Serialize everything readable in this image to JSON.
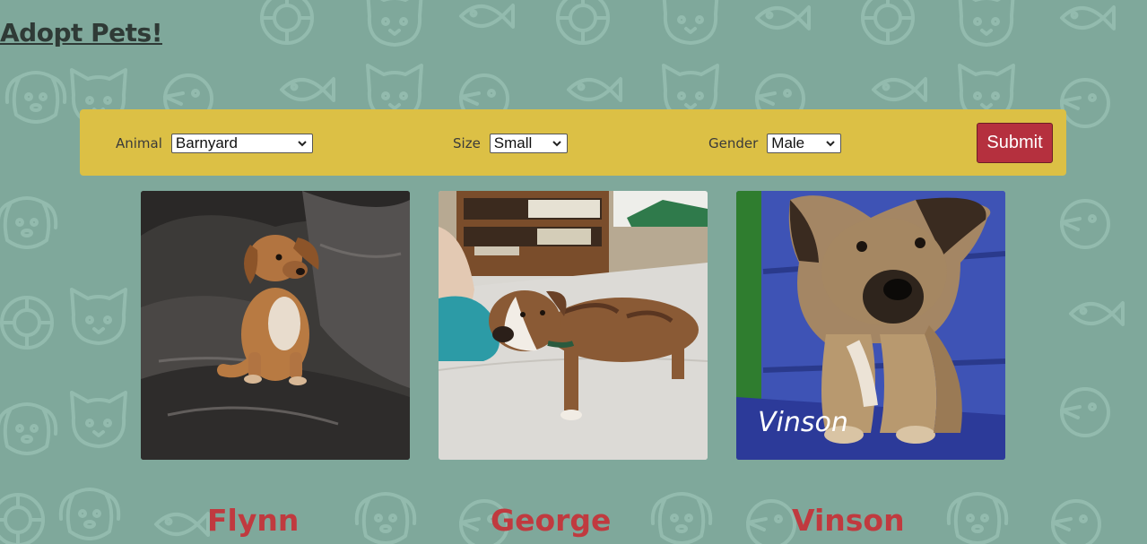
{
  "page": {
    "title": "Adopt Pets!"
  },
  "filters": {
    "animal": {
      "label": "Animal",
      "selected": "Barnyard"
    },
    "size": {
      "label": "Size",
      "selected": "Small"
    },
    "gender": {
      "label": "Gender",
      "selected": "Male"
    },
    "submit_label": "Submit"
  },
  "pets": [
    {
      "name": "Flynn",
      "photo_desc": "puppy-on-leather-couch"
    },
    {
      "name": "George",
      "photo_desc": "brindle-dog-in-shelter"
    },
    {
      "name": "Vinson",
      "photo_desc": "shepherd-puppy-on-blue-chair",
      "photo_caption": "Vinson"
    }
  ],
  "colors": {
    "background": "#7fa89b",
    "filter_bar": "#dcc045",
    "submit": "#b5303e",
    "pet_name": "#c03a3f",
    "title": "#2f3a36"
  }
}
